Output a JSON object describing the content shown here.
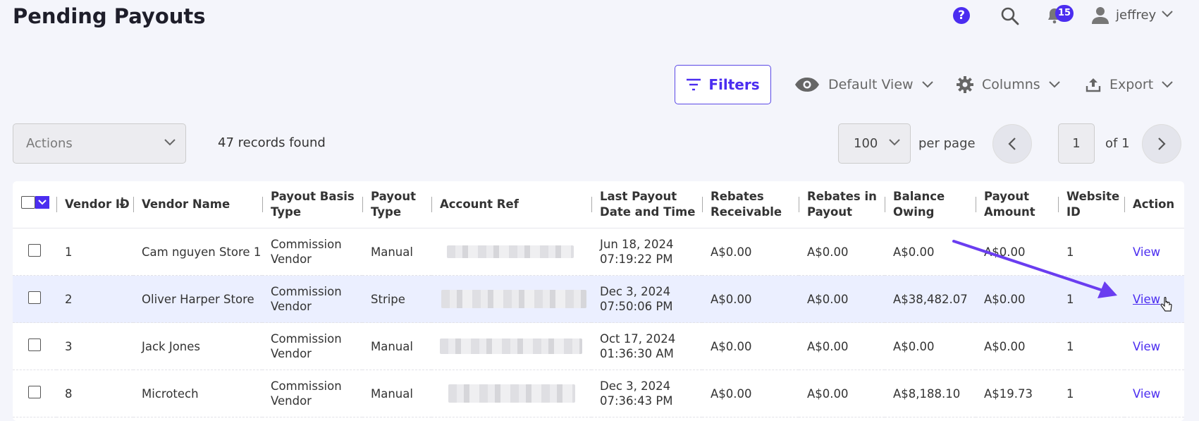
{
  "page": {
    "title": "Pending Payouts"
  },
  "topbar": {
    "help_label": "?",
    "notification_count": "15",
    "username": "jeffrey"
  },
  "toolbar": {
    "filters_label": "Filters",
    "view_label": "Default View",
    "columns_label": "Columns",
    "export_label": "Export"
  },
  "controls": {
    "actions_placeholder": "Actions",
    "records_text": "47 records found",
    "per_page_value": "100",
    "per_page_label": "per page",
    "page_value": "1",
    "of_label": "of 1"
  },
  "table": {
    "headers": [
      "Vendor ID",
      "Vendor Name",
      "Payout Basis Type",
      "Payout Type",
      "Account Ref",
      "Last Payout Date and Time",
      "Rebates Receivable",
      "Rebates in Payout",
      "Balance Owing",
      "Payout Amount",
      "Website ID",
      "Action"
    ],
    "rows": [
      {
        "id": "1",
        "name": "Cam nguyen Store 1",
        "basis": "Commission Vendor",
        "type": "Manual",
        "date": "Jun 18, 2024 07:19:22 PM",
        "rec": "A$0.00",
        "inpay": "A$0.00",
        "bal": "A$0.00",
        "amt": "A$0.00",
        "web": "1",
        "action": "View"
      },
      {
        "id": "2",
        "name": "Oliver Harper Store",
        "basis": "Commission Vendor",
        "type": "Stripe",
        "date": "Dec 3, 2024 07:50:06 PM",
        "rec": "A$0.00",
        "inpay": "A$0.00",
        "bal": "A$38,482.07",
        "amt": "A$0.00",
        "web": "1",
        "action": "View"
      },
      {
        "id": "3",
        "name": "Jack Jones",
        "basis": "Commission Vendor",
        "type": "Manual",
        "date": "Oct 17, 2024 01:36:30 AM",
        "rec": "A$0.00",
        "inpay": "A$0.00",
        "bal": "A$0.00",
        "amt": "A$0.00",
        "web": "1",
        "action": "View"
      },
      {
        "id": "8",
        "name": "Microtech",
        "basis": "Commission Vendor",
        "type": "Manual",
        "date": "Dec 3, 2024 07:36:43 PM",
        "rec": "A$0.00",
        "inpay": "A$0.00",
        "bal": "A$8,188.10",
        "amt": "A$19.73",
        "web": "1",
        "action": "View"
      }
    ]
  },
  "colors": {
    "accent": "#4b2df0",
    "highlight_row": "#ebefff",
    "annotation_arrow": "#6a3df0"
  }
}
